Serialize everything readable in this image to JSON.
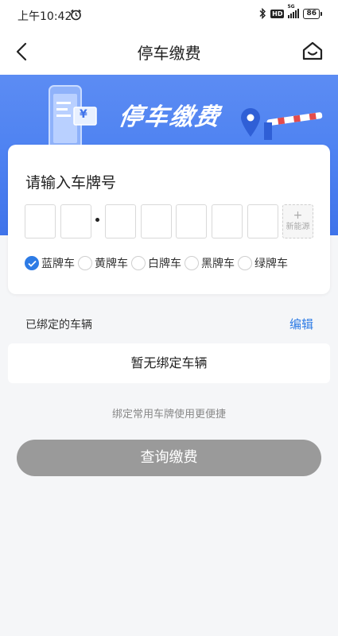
{
  "status_bar": {
    "time": "上午10:42",
    "hd_badge": "HD",
    "network_type": "5G",
    "battery": "86"
  },
  "nav": {
    "title": "停车缴费"
  },
  "banner": {
    "title": "停车缴费",
    "bill_symbol": "¥"
  },
  "plate_input": {
    "heading": "请输入车牌号",
    "new_energy_plus": "+",
    "new_energy_label": "新能源"
  },
  "plate_colors": [
    {
      "label": "蓝牌车",
      "selected": true
    },
    {
      "label": "黄牌车",
      "selected": false
    },
    {
      "label": "白牌车",
      "selected": false
    },
    {
      "label": "黑牌车",
      "selected": false
    },
    {
      "label": "绿牌车",
      "selected": false
    }
  ],
  "bound": {
    "title": "已绑定的车辆",
    "edit_label": "编辑",
    "empty_text": "暂无绑定车辆",
    "hint": "绑定常用车牌使用更便捷"
  },
  "query_button_label": "查询缴费",
  "colors": {
    "accent": "#2d7be5",
    "banner": "#4f83f2",
    "button_disabled": "#9a9a9a"
  }
}
